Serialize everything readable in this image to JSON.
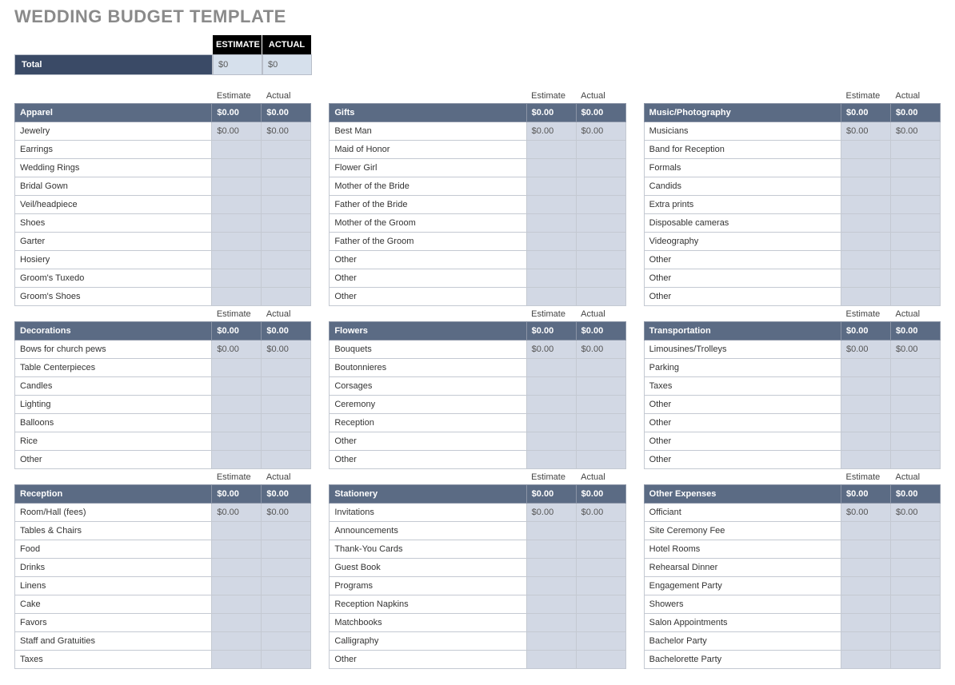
{
  "page_title": "WEDDING BUDGET TEMPLATE",
  "labels": {
    "estimate_upper": "ESTIMATE",
    "actual_upper": "ACTUAL",
    "estimate": "Estimate",
    "actual": "Actual",
    "total": "Total"
  },
  "totals": {
    "estimate": "$0",
    "actual": "$0"
  },
  "columns": [
    [
      {
        "name": "Apparel",
        "subtotal_estimate": "$0.00",
        "subtotal_actual": "$0.00",
        "items": [
          {
            "name": "Jewelry",
            "estimate": "$0.00",
            "actual": "$0.00"
          },
          {
            "name": "Earrings",
            "estimate": "",
            "actual": ""
          },
          {
            "name": "Wedding Rings",
            "estimate": "",
            "actual": ""
          },
          {
            "name": "Bridal Gown",
            "estimate": "",
            "actual": ""
          },
          {
            "name": "Veil/headpiece",
            "estimate": "",
            "actual": ""
          },
          {
            "name": "Shoes",
            "estimate": "",
            "actual": ""
          },
          {
            "name": "Garter",
            "estimate": "",
            "actual": ""
          },
          {
            "name": "Hosiery",
            "estimate": "",
            "actual": ""
          },
          {
            "name": "Groom's Tuxedo",
            "estimate": "",
            "actual": ""
          },
          {
            "name": "Groom's Shoes",
            "estimate": "",
            "actual": ""
          }
        ]
      },
      {
        "name": "Decorations",
        "subtotal_estimate": "$0.00",
        "subtotal_actual": "$0.00",
        "items": [
          {
            "name": "Bows for church pews",
            "estimate": "$0.00",
            "actual": "$0.00"
          },
          {
            "name": "Table Centerpieces",
            "estimate": "",
            "actual": ""
          },
          {
            "name": "Candles",
            "estimate": "",
            "actual": ""
          },
          {
            "name": "Lighting",
            "estimate": "",
            "actual": ""
          },
          {
            "name": "Balloons",
            "estimate": "",
            "actual": ""
          },
          {
            "name": "Rice",
            "estimate": "",
            "actual": ""
          },
          {
            "name": "Other",
            "estimate": "",
            "actual": ""
          }
        ]
      },
      {
        "name": "Reception",
        "subtotal_estimate": "$0.00",
        "subtotal_actual": "$0.00",
        "items": [
          {
            "name": "Room/Hall (fees)",
            "estimate": "$0.00",
            "actual": "$0.00"
          },
          {
            "name": "Tables & Chairs",
            "estimate": "",
            "actual": ""
          },
          {
            "name": "Food",
            "estimate": "",
            "actual": ""
          },
          {
            "name": "Drinks",
            "estimate": "",
            "actual": ""
          },
          {
            "name": "Linens",
            "estimate": "",
            "actual": ""
          },
          {
            "name": "Cake",
            "estimate": "",
            "actual": ""
          },
          {
            "name": "Favors",
            "estimate": "",
            "actual": ""
          },
          {
            "name": "Staff and Gratuities",
            "estimate": "",
            "actual": ""
          },
          {
            "name": "Taxes",
            "estimate": "",
            "actual": ""
          }
        ]
      }
    ],
    [
      {
        "name": "Gifts",
        "subtotal_estimate": "$0.00",
        "subtotal_actual": "$0.00",
        "items": [
          {
            "name": "Best Man",
            "estimate": "$0.00",
            "actual": "$0.00"
          },
          {
            "name": "Maid of Honor",
            "estimate": "",
            "actual": ""
          },
          {
            "name": "Flower Girl",
            "estimate": "",
            "actual": ""
          },
          {
            "name": "Mother of the Bride",
            "estimate": "",
            "actual": ""
          },
          {
            "name": "Father of the Bride",
            "estimate": "",
            "actual": ""
          },
          {
            "name": "Mother of the Groom",
            "estimate": "",
            "actual": ""
          },
          {
            "name": "Father of the Groom",
            "estimate": "",
            "actual": ""
          },
          {
            "name": "Other",
            "estimate": "",
            "actual": ""
          },
          {
            "name": "Other",
            "estimate": "",
            "actual": ""
          },
          {
            "name": "Other",
            "estimate": "",
            "actual": ""
          }
        ]
      },
      {
        "name": "Flowers",
        "subtotal_estimate": "$0.00",
        "subtotal_actual": "$0.00",
        "items": [
          {
            "name": "Bouquets",
            "estimate": "$0.00",
            "actual": "$0.00"
          },
          {
            "name": "Boutonnieres",
            "estimate": "",
            "actual": ""
          },
          {
            "name": "Corsages",
            "estimate": "",
            "actual": ""
          },
          {
            "name": "Ceremony",
            "estimate": "",
            "actual": ""
          },
          {
            "name": "Reception",
            "estimate": "",
            "actual": ""
          },
          {
            "name": "Other",
            "estimate": "",
            "actual": ""
          },
          {
            "name": "Other",
            "estimate": "",
            "actual": ""
          }
        ]
      },
      {
        "name": "Stationery",
        "subtotal_estimate": "$0.00",
        "subtotal_actual": "$0.00",
        "items": [
          {
            "name": "Invitations",
            "estimate": "$0.00",
            "actual": "$0.00"
          },
          {
            "name": "Announcements",
            "estimate": "",
            "actual": ""
          },
          {
            "name": "Thank-You Cards",
            "estimate": "",
            "actual": ""
          },
          {
            "name": "Guest Book",
            "estimate": "",
            "actual": ""
          },
          {
            "name": "Programs",
            "estimate": "",
            "actual": ""
          },
          {
            "name": "Reception Napkins",
            "estimate": "",
            "actual": ""
          },
          {
            "name": "Matchbooks",
            "estimate": "",
            "actual": ""
          },
          {
            "name": "Calligraphy",
            "estimate": "",
            "actual": ""
          },
          {
            "name": "Other",
            "estimate": "",
            "actual": ""
          }
        ]
      }
    ],
    [
      {
        "name": "Music/Photography",
        "subtotal_estimate": "$0.00",
        "subtotal_actual": "$0.00",
        "items": [
          {
            "name": "Musicians",
            "estimate": "$0.00",
            "actual": "$0.00"
          },
          {
            "name": "Band for Reception",
            "estimate": "",
            "actual": ""
          },
          {
            "name": "Formals",
            "estimate": "",
            "actual": ""
          },
          {
            "name": "Candids",
            "estimate": "",
            "actual": ""
          },
          {
            "name": "Extra prints",
            "estimate": "",
            "actual": ""
          },
          {
            "name": "Disposable cameras",
            "estimate": "",
            "actual": ""
          },
          {
            "name": "Videography",
            "estimate": "",
            "actual": ""
          },
          {
            "name": "Other",
            "estimate": "",
            "actual": ""
          },
          {
            "name": "Other",
            "estimate": "",
            "actual": ""
          },
          {
            "name": "Other",
            "estimate": "",
            "actual": ""
          }
        ]
      },
      {
        "name": "Transportation",
        "subtotal_estimate": "$0.00",
        "subtotal_actual": "$0.00",
        "items": [
          {
            "name": "Limousines/Trolleys",
            "estimate": "$0.00",
            "actual": "$0.00"
          },
          {
            "name": "Parking",
            "estimate": "",
            "actual": ""
          },
          {
            "name": "Taxes",
            "estimate": "",
            "actual": ""
          },
          {
            "name": "Other",
            "estimate": "",
            "actual": ""
          },
          {
            "name": "Other",
            "estimate": "",
            "actual": ""
          },
          {
            "name": "Other",
            "estimate": "",
            "actual": ""
          },
          {
            "name": "Other",
            "estimate": "",
            "actual": ""
          }
        ]
      },
      {
        "name": "Other Expenses",
        "subtotal_estimate": "$0.00",
        "subtotal_actual": "$0.00",
        "items": [
          {
            "name": "Officiant",
            "estimate": "$0.00",
            "actual": "$0.00"
          },
          {
            "name": "Site Ceremony Fee",
            "estimate": "",
            "actual": ""
          },
          {
            "name": "Hotel Rooms",
            "estimate": "",
            "actual": ""
          },
          {
            "name": "Rehearsal Dinner",
            "estimate": "",
            "actual": ""
          },
          {
            "name": "Engagement Party",
            "estimate": "",
            "actual": ""
          },
          {
            "name": "Showers",
            "estimate": "",
            "actual": ""
          },
          {
            "name": "Salon Appointments",
            "estimate": "",
            "actual": ""
          },
          {
            "name": "Bachelor Party",
            "estimate": "",
            "actual": ""
          },
          {
            "name": "Bachelorette Party",
            "estimate": "",
            "actual": ""
          }
        ]
      }
    ]
  ]
}
